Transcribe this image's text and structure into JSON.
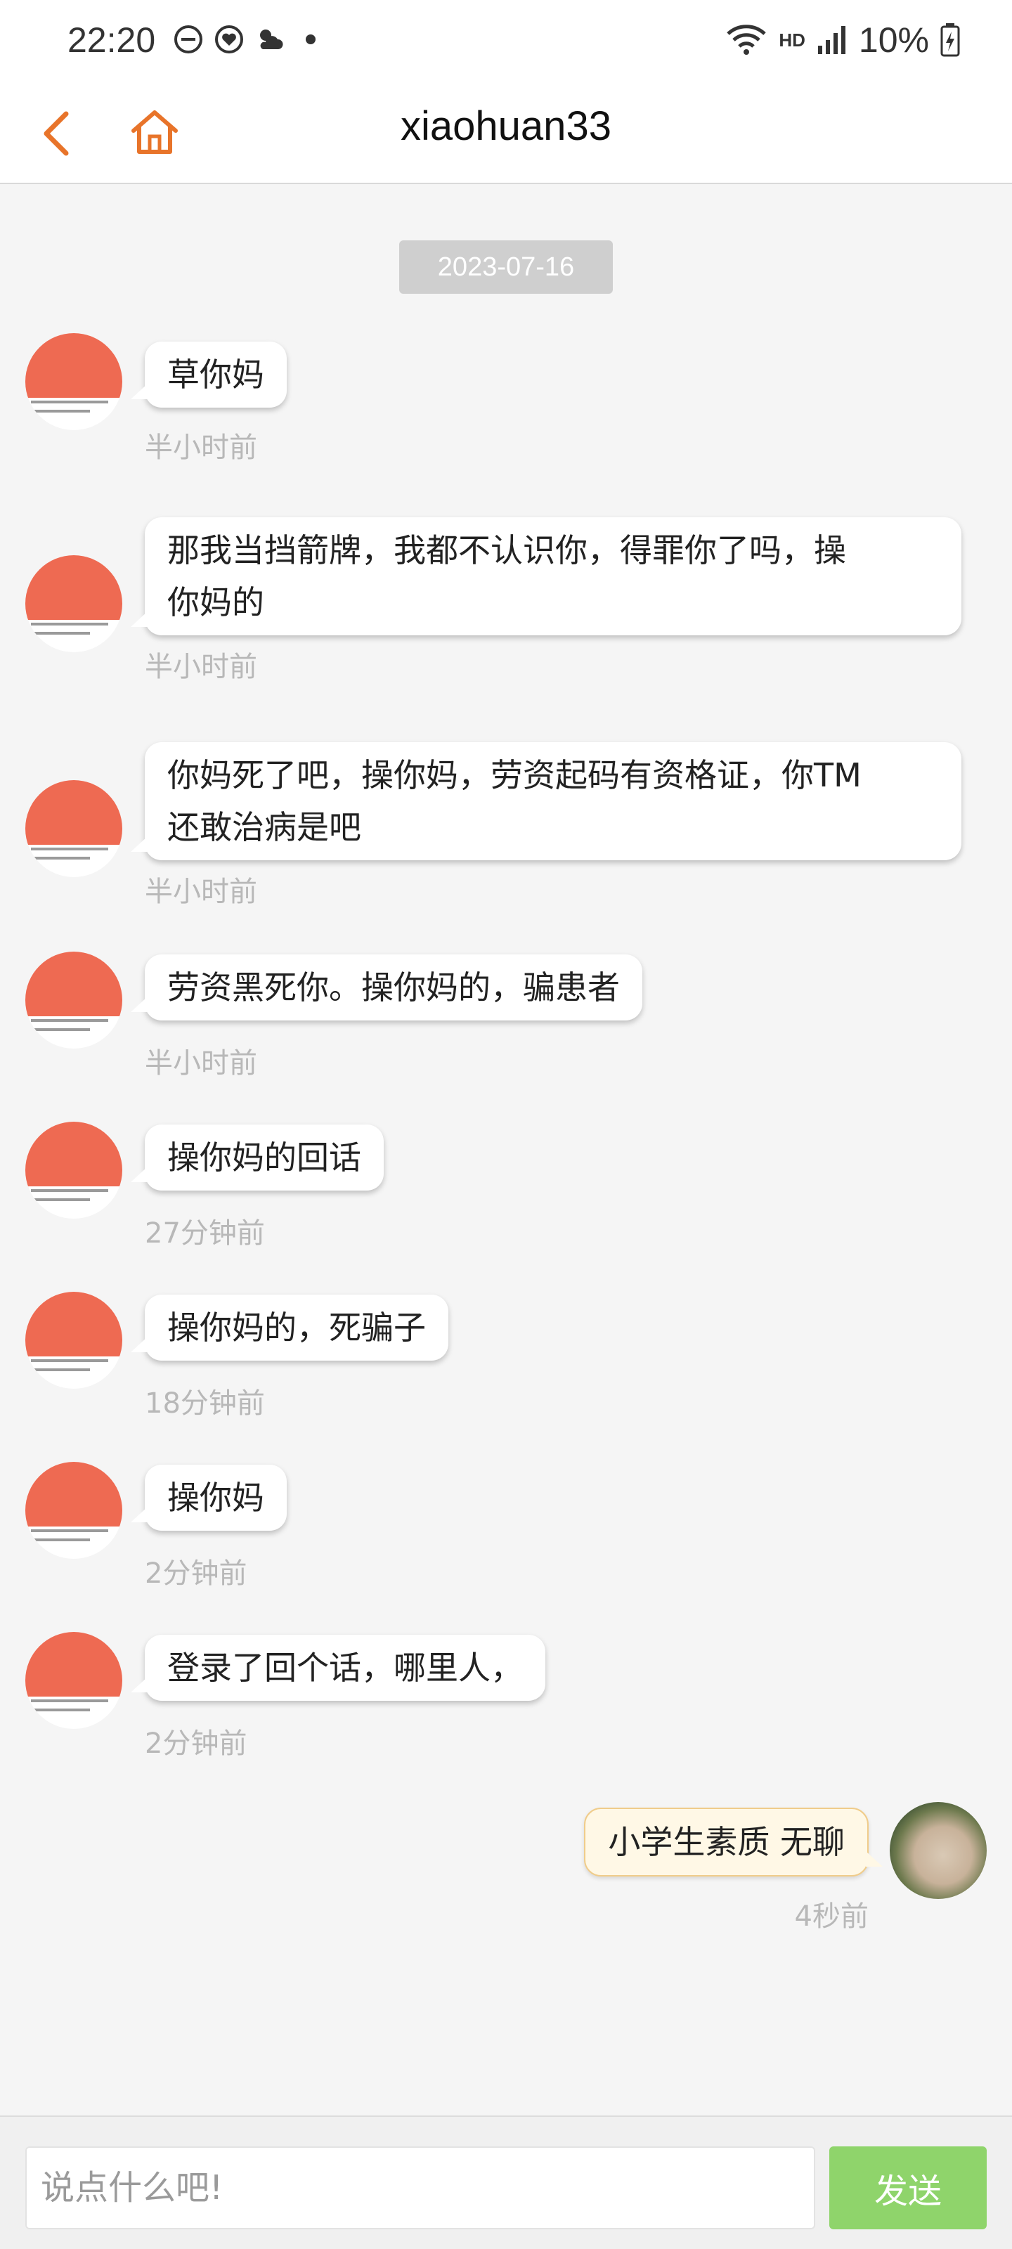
{
  "status_bar": {
    "time": "22:20",
    "network": "HD",
    "battery": "10%",
    "icons": [
      "do-not-disturb-icon",
      "heart-app-icon",
      "weather-icon",
      "dot-icon",
      "wifi-icon",
      "signal-icon",
      "battery-icon"
    ]
  },
  "nav": {
    "title": "xiaohuan33",
    "accent_color": "#e8742a"
  },
  "chat": {
    "date": "2023-07-16",
    "messages": [
      {
        "side": "in",
        "text": "草你妈",
        "time": "半小时前"
      },
      {
        "side": "in",
        "line1": "那我当挡箭牌，我都不认识你，得罪你了吗，操",
        "line2": "你妈的",
        "time": "半小时前"
      },
      {
        "side": "in",
        "line1": "你妈死了吧，操你妈，劳资起码有资格证，你TM",
        "line2": "还敢治病是吧",
        "time": "半小时前"
      },
      {
        "side": "in",
        "text": "劳资黑死你。操你妈的，骗患者",
        "time": "半小时前"
      },
      {
        "side": "in",
        "text": "操你妈的回话",
        "time": "27分钟前"
      },
      {
        "side": "in",
        "text": "操你妈的，死骗子",
        "time": "18分钟前"
      },
      {
        "side": "in",
        "text": "操你妈",
        "time": "2分钟前"
      },
      {
        "side": "in",
        "text": "登录了回个话，哪里人，",
        "time": "2分钟前"
      },
      {
        "side": "out",
        "text": "小学生素质 无聊",
        "time": "4秒前"
      }
    ]
  },
  "composer": {
    "placeholder": "说点什么吧!",
    "send_label": "发送",
    "send_color": "#8fd46b"
  }
}
